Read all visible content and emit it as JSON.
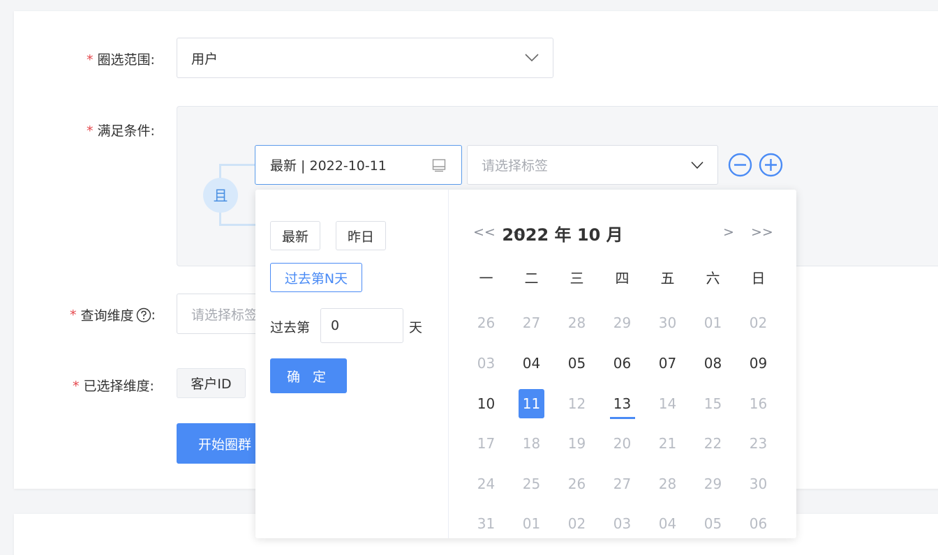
{
  "form": {
    "scope_label": "圈选范围:",
    "scope_value": "用户",
    "condition_label": "满足条件:",
    "condition_logic": "且",
    "date_value": "最新 | 2022-10-11",
    "tag_placeholder": "请选择标签",
    "dimension_label": "查询维度",
    "dimension_colon": ":",
    "dimension_placeholder": "请选择标签",
    "selected_label": "已选择维度:",
    "selected_chip": "客户ID",
    "start_button": "开始圈群",
    "required_mark": "*"
  },
  "date_picker": {
    "quick": {
      "latest": "最新",
      "yesterday": "昨日",
      "past_n": "过去第N天"
    },
    "past_prefix": "过去第",
    "past_value": "0",
    "past_unit": "天",
    "confirm": "确 定",
    "nav": {
      "prev_year": "<<",
      "prev_month": "<",
      "next_month": ">",
      "next_year": ">>"
    },
    "title": "2022 年 10 月",
    "weekdays": [
      "一",
      "二",
      "三",
      "四",
      "五",
      "六",
      "日"
    ],
    "weeks": [
      [
        [
          "26",
          "muted"
        ],
        [
          "27",
          "muted"
        ],
        [
          "28",
          "muted"
        ],
        [
          "29",
          "muted"
        ],
        [
          "30",
          "muted"
        ],
        [
          "01",
          "muted"
        ],
        [
          "02",
          "muted"
        ]
      ],
      [
        [
          "03",
          "muted"
        ],
        [
          "04",
          "cur"
        ],
        [
          "05",
          "cur"
        ],
        [
          "06",
          "cur"
        ],
        [
          "07",
          "cur"
        ],
        [
          "08",
          "cur"
        ],
        [
          "09",
          "cur"
        ]
      ],
      [
        [
          "10",
          "cur"
        ],
        [
          "11",
          "sel"
        ],
        [
          "12",
          "muted"
        ],
        [
          "13",
          "today"
        ],
        [
          "14",
          "muted"
        ],
        [
          "15",
          "muted"
        ],
        [
          "16",
          "muted"
        ]
      ],
      [
        [
          "17",
          "muted"
        ],
        [
          "18",
          "muted"
        ],
        [
          "19",
          "muted"
        ],
        [
          "20",
          "muted"
        ],
        [
          "21",
          "muted"
        ],
        [
          "22",
          "muted"
        ],
        [
          "23",
          "muted"
        ]
      ],
      [
        [
          "24",
          "muted"
        ],
        [
          "25",
          "muted"
        ],
        [
          "26",
          "muted"
        ],
        [
          "27",
          "muted"
        ],
        [
          "28",
          "muted"
        ],
        [
          "29",
          "muted"
        ],
        [
          "30",
          "muted"
        ]
      ],
      [
        [
          "31",
          "muted"
        ],
        [
          "01",
          "muted"
        ],
        [
          "02",
          "muted"
        ],
        [
          "03",
          "muted"
        ],
        [
          "04",
          "muted"
        ],
        [
          "05",
          "muted"
        ],
        [
          "06",
          "muted"
        ]
      ]
    ]
  },
  "colors": {
    "primary": "#4a8bf5",
    "required": "#e5484d"
  }
}
